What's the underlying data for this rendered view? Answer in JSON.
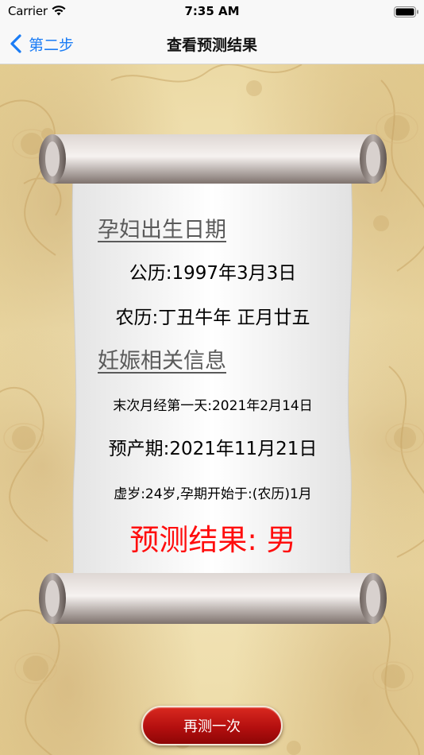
{
  "status_bar": {
    "carrier": "Carrier",
    "time": "7:35 AM",
    "wifi_icon": "wifi-icon",
    "battery_icon": "battery-icon"
  },
  "nav": {
    "back_label": "第二步",
    "back_icon": "chevron-left-icon",
    "title": "查看预测结果",
    "accent_color": "#1a7cf5"
  },
  "result": {
    "mother_birth_heading": "孕妇出生日期",
    "solar_date": "公历:1997年3月3日",
    "lunar_date": "农历:丁丑牛年 正月廿五",
    "pregnancy_heading": "妊娠相关信息",
    "last_period": "末次月经第一天:2021年2月14日",
    "due_date": "预产期:2021年11月21日",
    "age_info": "虚岁:24岁,孕期开始于:(农历)1月",
    "prediction": "预测结果: 男",
    "prediction_color": "#ff0d0d"
  },
  "actions": {
    "retry_label": "再测一次",
    "retry_color": "#c01414"
  }
}
